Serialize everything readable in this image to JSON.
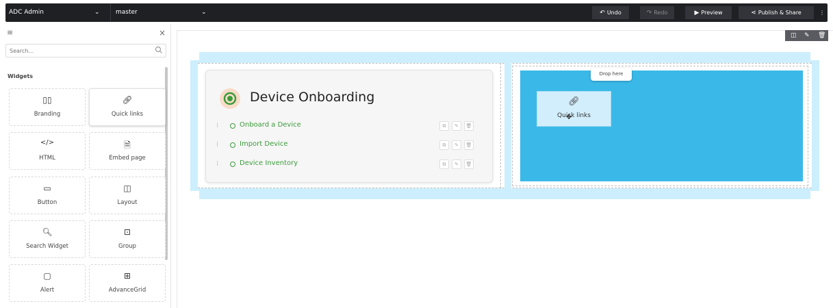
{
  "topbar": {
    "app_select": "ADC Admin",
    "branch_select": "master",
    "undo": "Undo",
    "redo": "Redo",
    "preview": "Preview",
    "publish": "Publish & Share",
    "more": "⋮"
  },
  "sidebar": {
    "search_placeholder": "Search...",
    "heading": "Widgets",
    "widgets": [
      {
        "label": "Branding",
        "icon": "branding-icon"
      },
      {
        "label": "Quick links",
        "icon": "link-icon"
      },
      {
        "label": "HTML",
        "icon": "code-icon"
      },
      {
        "label": "Embed page",
        "icon": "embed-page-icon"
      },
      {
        "label": "Button",
        "icon": "button-icon"
      },
      {
        "label": "Layout",
        "icon": "layout-icon"
      },
      {
        "label": "Search Widget",
        "icon": "search-icon"
      },
      {
        "label": "Group",
        "icon": "group-icon"
      },
      {
        "label": "Alert",
        "icon": "alert-icon"
      },
      {
        "label": "AdvanceGrid",
        "icon": "grid-icon"
      }
    ]
  },
  "canvas": {
    "card": {
      "title": "Device Onboarding",
      "links": [
        "Onboard a Device",
        "Import Device",
        "Device Inventory"
      ]
    },
    "drop_tag": "Drop here",
    "drag_ghost_label": "Quick links",
    "colors": {
      "drop_zone": "#3ab9e8",
      "row_highlight": "#cdeffd",
      "link_green": "#3c9b3c",
      "topbar": "#1f2024"
    }
  }
}
